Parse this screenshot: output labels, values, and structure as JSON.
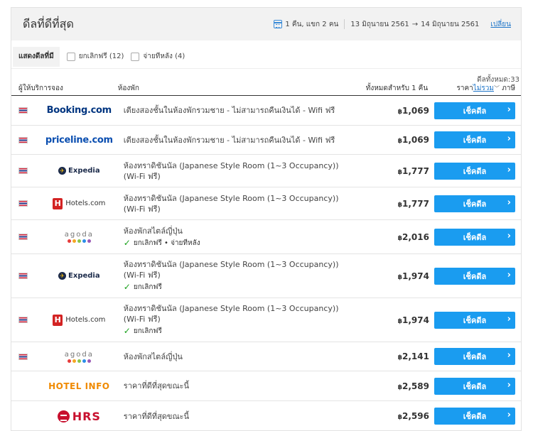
{
  "header": {
    "title": "ดีลที่ดีที่สุด",
    "guests": "1 คืน, แขก 2 คน",
    "checkin": "13 มิถุนายน 2561",
    "arrow": "→",
    "checkout": "14 มิถุนายน 2561",
    "change_link": "เปลี่ยน"
  },
  "filters": {
    "label": "แสดงดีลที่มี",
    "options": [
      {
        "label": "ยกเลิกฟรี (12)"
      },
      {
        "label": "จ่ายทีหลัง (4)"
      }
    ]
  },
  "total": "ดีลทั้งหมด:33",
  "columns": {
    "provider": "ผู้ให้บริการจอง",
    "room": "ห้องพัก",
    "total_price": "ทั้งหมดสำหรับ 1 คืน",
    "price_prefix": "ราคา",
    "price_sort": "ไม่รวม",
    "price_suffix": "ภาษี"
  },
  "rows": [
    {
      "provider": "Booking.com",
      "room": "เตียงสองชั้นในห้องพักรวมชาย - ไม่สามารถคืนเงินได้ - Wifi ฟรี",
      "perk": "",
      "currency": "฿",
      "price": "1,069",
      "button": "เช็คดีล"
    },
    {
      "provider": "priceline.com",
      "room": "เตียงสองชั้นในห้องพักรวมชาย - ไม่สามารถคืนเงินได้ - Wifi ฟรี",
      "perk": "",
      "currency": "฿",
      "price": "1,069",
      "button": "เช็คดีล"
    },
    {
      "provider": "Expedia",
      "room": "ห้องทราดิชันนัล (Japanese Style Room (1~3 Occupancy)) (Wi-Fi ฟรี)",
      "perk": "",
      "currency": "฿",
      "price": "1,777",
      "button": "เช็คดีล"
    },
    {
      "provider": "Hotels.com",
      "room": "ห้องทราดิชันนัล (Japanese Style Room (1~3 Occupancy)) (Wi-Fi ฟรี)",
      "perk": "",
      "currency": "฿",
      "price": "1,777",
      "button": "เช็คดีล"
    },
    {
      "provider": "agoda",
      "room": "ห้องพักสไตล์ญี่ปุ่น",
      "perk": "ยกเลิกฟรี • จ่ายทีหลัง",
      "currency": "฿",
      "price": "2,016",
      "button": "เช็คดีล"
    },
    {
      "provider": "Expedia",
      "room": "ห้องทราดิชันนัล (Japanese Style Room (1~3 Occupancy)) (Wi-Fi ฟรี)",
      "perk": "ยกเลิกฟรี",
      "currency": "฿",
      "price": "1,974",
      "button": "เช็คดีล"
    },
    {
      "provider": "Hotels.com",
      "room": "ห้องทราดิชันนัล (Japanese Style Room (1~3 Occupancy)) (Wi-Fi ฟรี)",
      "perk": "ยกเลิกฟรี",
      "currency": "฿",
      "price": "1,974",
      "button": "เช็คดีล"
    },
    {
      "provider": "agoda",
      "room": "ห้องพักสไตล์ญี่ปุ่น",
      "perk": "",
      "currency": "฿",
      "price": "2,141",
      "button": "เช็คดีล"
    },
    {
      "provider": "HOTEL INFO",
      "room": "ราคาที่ดีที่สุดขณะนี้",
      "perk": "",
      "currency": "฿",
      "price": "2,589",
      "button": "เช็คดีล"
    },
    {
      "provider": "HRS",
      "room": "ราคาที่ดีที่สุดขณะนี้",
      "perk": "",
      "currency": "฿",
      "price": "2,596",
      "button": "เช็คดีล"
    }
  ],
  "colors": {
    "button": "#1a9cf0",
    "link": "#1a73c8",
    "check": "#19a11b"
  }
}
